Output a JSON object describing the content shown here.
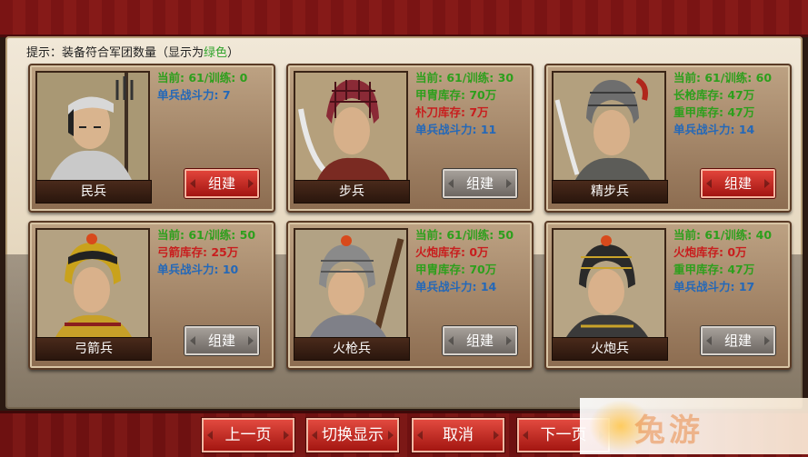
{
  "hint": {
    "prefix": "提示：装备符合军团数量（显示为",
    "green_word": "绿色",
    "suffix": "）"
  },
  "units": [
    {
      "name": "民兵",
      "stats": [
        {
          "text": "当前: 61/训练: 0",
          "color": "green"
        },
        {
          "text": "单兵战斗力: 7",
          "color": "blue"
        }
      ],
      "button": "组建",
      "button_state": "active"
    },
    {
      "name": "步兵",
      "stats": [
        {
          "text": "当前: 61/训练: 30",
          "color": "green"
        },
        {
          "text": "甲胄库存: 70万",
          "color": "green"
        },
        {
          "text": "朴刀库存: 7万",
          "color": "red"
        },
        {
          "text": "单兵战斗力: 11",
          "color": "blue"
        }
      ],
      "button": "组建",
      "button_state": "disabled"
    },
    {
      "name": "精步兵",
      "stats": [
        {
          "text": "当前: 61/训练: 60",
          "color": "green"
        },
        {
          "text": "长枪库存: 47万",
          "color": "green"
        },
        {
          "text": "重甲库存: 47万",
          "color": "green"
        },
        {
          "text": "单兵战斗力: 14",
          "color": "blue"
        }
      ],
      "button": "组建",
      "button_state": "active"
    },
    {
      "name": "弓箭兵",
      "stats": [
        {
          "text": "当前: 61/训练: 50",
          "color": "green"
        },
        {
          "text": "弓箭库存: 25万",
          "color": "red"
        },
        {
          "text": "单兵战斗力: 10",
          "color": "blue"
        }
      ],
      "button": "组建",
      "button_state": "disabled"
    },
    {
      "name": "火枪兵",
      "stats": [
        {
          "text": "当前: 61/训练: 50",
          "color": "green"
        },
        {
          "text": "火炮库存: 0万",
          "color": "red"
        },
        {
          "text": "甲胄库存: 70万",
          "color": "green"
        },
        {
          "text": "单兵战斗力: 14",
          "color": "blue"
        }
      ],
      "button": "组建",
      "button_state": "disabled"
    },
    {
      "name": "火炮兵",
      "stats": [
        {
          "text": "当前: 61/训练: 40",
          "color": "green"
        },
        {
          "text": "火炮库存: 0万",
          "color": "red"
        },
        {
          "text": "重甲库存: 47万",
          "color": "green"
        },
        {
          "text": "单兵战斗力: 17",
          "color": "blue"
        }
      ],
      "button": "组建",
      "button_state": "disabled"
    }
  ],
  "nav": {
    "prev": "上一页",
    "toggle": "切换显示",
    "cancel": "取消",
    "next": "下一页"
  },
  "watermark": "兔游"
}
